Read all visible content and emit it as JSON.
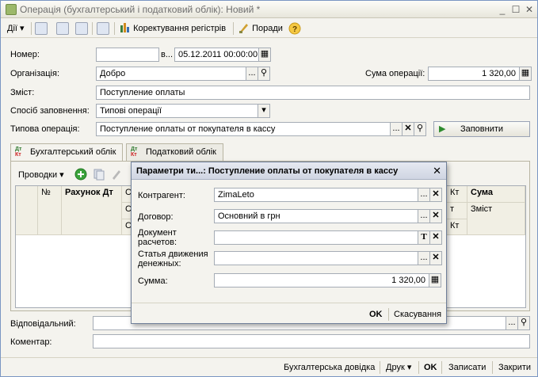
{
  "window": {
    "title": "Операція (бухгалтерський і податковий облік): Новий *"
  },
  "toolbar": {
    "actions_label": "Дії",
    "correct_registers_label": "Коректування регістрів",
    "tips_label": "Поради"
  },
  "form": {
    "number_label": "Номер:",
    "number_value": "",
    "date_prefix": "в...",
    "date_value": "05.12.2011 00:00:00",
    "organization_label": "Організація:",
    "organization_value": "Добро",
    "amount_label": "Сума операції:",
    "amount_value": "1 320,00",
    "content_label": "Зміст:",
    "content_value": "Поступление оплаты",
    "fill_method_label": "Спосіб заповнення:",
    "fill_method_value": "Типові операції",
    "typical_op_label": "Типова операція:",
    "typical_op_value": "Поступление оплаты от покупателя в кассу",
    "fill_button_label": "Заповнити",
    "responsible_label": "Відповідальний:",
    "responsible_value": "",
    "comment_label": "Коментар:",
    "comment_value": ""
  },
  "tabs": [
    {
      "label": "Бухгалтерський облік",
      "icon": "dt-kt-icon"
    },
    {
      "label": "Податковий облік",
      "icon": "dt-kt-icon"
    }
  ],
  "postings": {
    "menu_label": "Проводки",
    "columns": {
      "no": "№",
      "debit_account": "Рахунок Дт",
      "c1": "С",
      "c2": "С",
      "c3": "С",
      "kt": "Кт",
      "kt2": "Кт",
      "amount": "Сума",
      "content": "Зміст",
      "r": "т"
    }
  },
  "dialog": {
    "title": "Параметри ти...:  Поступление оплаты от покупателя в кассу",
    "counterparty_label": "Контрагент:",
    "counterparty_value": "ZimaLeto",
    "contract_label": "Договор:",
    "contract_value": "Основний в грн",
    "settlement_doc_label": "Документ расчетов:",
    "settlement_doc_value": "",
    "cashflow_label": "Статья движения денежных:",
    "cashflow_value": "",
    "sum_label": "Сумма:",
    "sum_value": "1 320,00",
    "ok_label": "OK",
    "cancel_label": "Скасування"
  },
  "statusbar": {
    "accounting_reference": "Бухгалтерська довідка",
    "print_label": "Друк",
    "ok_label": "OK",
    "save_label": "Записати",
    "close_label": "Закрити"
  },
  "colors": {
    "accent_green": "#2e8b2e",
    "window_bg": "#f4f3ee",
    "field_border": "#a5acb5"
  }
}
